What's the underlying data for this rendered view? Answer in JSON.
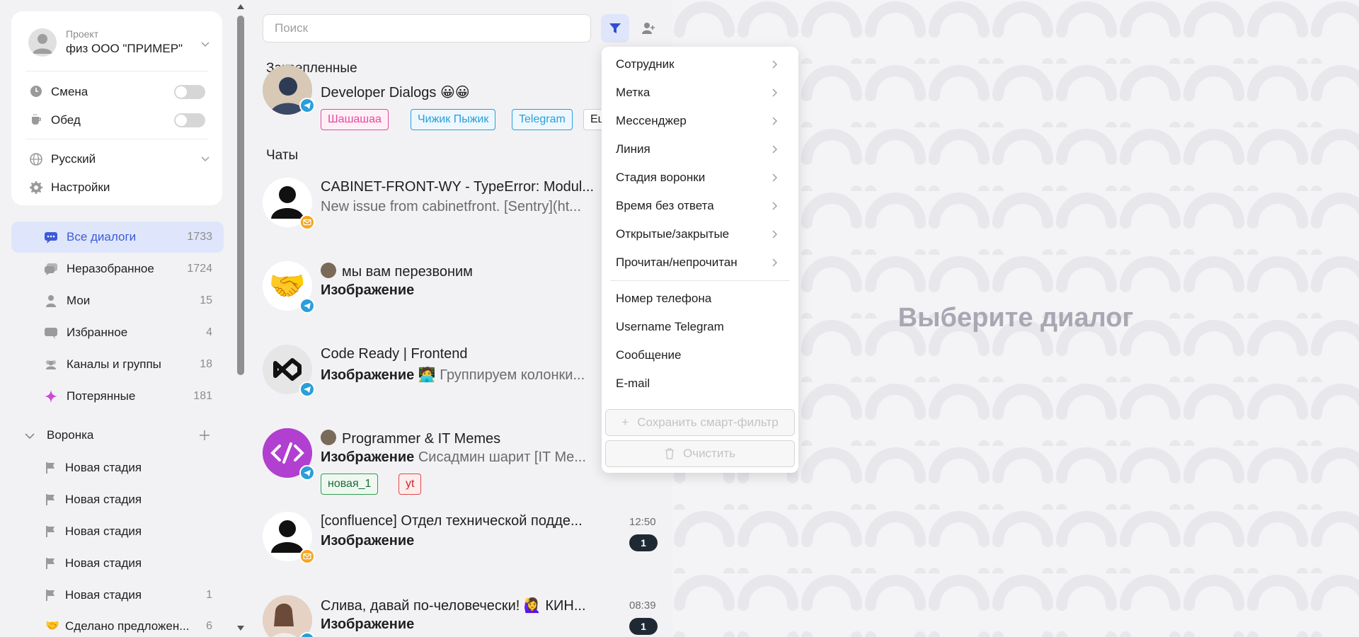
{
  "profile": {
    "project_label": "Проект",
    "project_name": "физ ООО \"ПРИМЕР\""
  },
  "toggles": [
    {
      "label": "Смена",
      "on": false
    },
    {
      "label": "Обед",
      "on": false
    }
  ],
  "language": {
    "label": "Русский"
  },
  "settings": {
    "label": "Настройки"
  },
  "nav": [
    {
      "label": "Все диалоги",
      "count": "1733",
      "active": true,
      "icon": "chat-bubble-icon"
    },
    {
      "label": "Неразобранное",
      "count": "1724",
      "icon": "inbox-chat-icon"
    },
    {
      "label": "Мои",
      "count": "15",
      "icon": "user-icon"
    },
    {
      "label": "Избранное",
      "count": "4",
      "icon": "star-chat-icon"
    },
    {
      "label": "Каналы и группы",
      "count": "18",
      "icon": "group-icon"
    },
    {
      "label": "Потерянные",
      "count": "181",
      "icon": "diamond-icon"
    }
  ],
  "funnel": {
    "label": "Воронка",
    "stages": [
      {
        "label": "Новая стадия",
        "count": ""
      },
      {
        "label": "Новая стадия",
        "count": ""
      },
      {
        "label": "Новая стадия",
        "count": ""
      },
      {
        "label": "Новая стадия",
        "count": ""
      },
      {
        "label": "Новая стадия",
        "count": "1"
      },
      {
        "label": "Сделано предложен...",
        "count": "6"
      }
    ]
  },
  "search": {
    "placeholder": "Поиск"
  },
  "sections": {
    "pinned": "Закрепленные",
    "chats": "Чаты"
  },
  "pinned_chat": {
    "title": "Developer Dialogs 😀😀",
    "tags": [
      "Шашашаа",
      "Чижик Пыжик",
      "Telegram",
      "Еще"
    ]
  },
  "chats": [
    {
      "title": "CABINET-FRONT-WY - TypeError: Modul...",
      "sub": "New issue from cabinetfront. [Sentry](ht...",
      "sub_bold": "",
      "channel": "email"
    },
    {
      "title": "мы вам перезвоним",
      "sub": "",
      "sub_bold": "Изображение",
      "channel": "telegram"
    },
    {
      "title": "Code Ready | Frontend",
      "sub": " 🧑‍💻 Группируем колонки...",
      "sub_bold": "Изображение",
      "channel": "telegram"
    },
    {
      "title": "Programmer & IT Memes",
      "sub": " Сисадмин шарит [IT Me...",
      "sub_bold": "Изображение",
      "channel": "telegram",
      "tags": [
        "новая_1",
        "yt"
      ]
    },
    {
      "title": "[confluence] Отдел технической подде...",
      "sub": "",
      "sub_bold": "Изображение",
      "time": "12:50",
      "unread": "1",
      "channel": "email"
    },
    {
      "title": "Слива, давай по-человечески! 🙋‍♀️ КИН...",
      "sub": "",
      "sub_bold": "Изображение",
      "time": "08:39",
      "unread": "1",
      "channel": "telegram"
    }
  ],
  "filter_menu": {
    "submenus": [
      "Сотрудник",
      "Метка",
      "Мессенджер",
      "Линия",
      "Стадия воронки",
      "Время без ответа",
      "Открытые/закрытые",
      "Прочитан/непрочитан"
    ],
    "fields": [
      "Номер телефона",
      "Username Telegram",
      "Сообщение",
      "E-mail"
    ],
    "save_label": "Сохранить смарт-фильтр",
    "clear_label": "Очистить"
  },
  "empty_state": {
    "title": "Выберите диалог"
  },
  "colors": {
    "accent": "#3b5bdb",
    "telegram": "#2a9fd9",
    "email": "#f5a623",
    "lost": "#c84bd6"
  }
}
